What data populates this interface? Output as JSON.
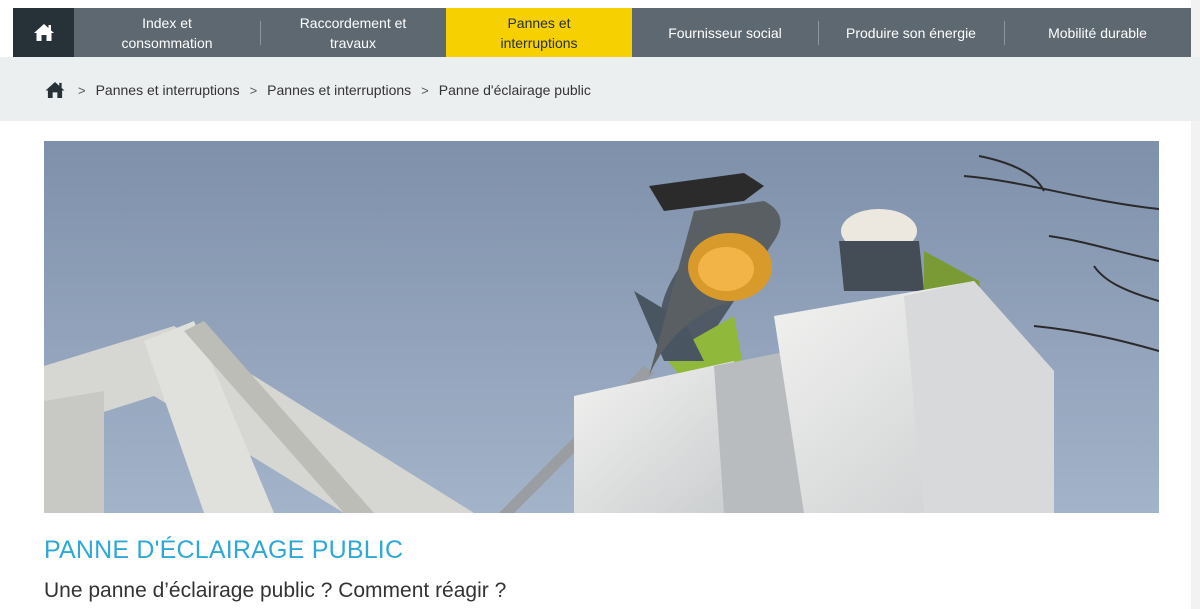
{
  "nav": {
    "home_icon": "home-icon",
    "items": [
      {
        "label": "Index et\nconsommation",
        "active": false
      },
      {
        "label": "Raccordement et\ntravaux",
        "active": false
      },
      {
        "label": "Pannes et\ninterruptions",
        "active": true
      },
      {
        "label": "Fournisseur social",
        "active": false
      },
      {
        "label": "Produire son énergie",
        "active": false
      },
      {
        "label": "Mobilité durable",
        "active": false
      }
    ]
  },
  "breadcrumb": {
    "home_icon": "home-icon",
    "separator": ">",
    "items": [
      "Pannes et interruptions",
      "Pannes et interruptions",
      "Panne d'éclairage public"
    ]
  },
  "page": {
    "title": "PANNE D'ÉCLAIRAGE PUBLIC",
    "subtitle": "Une panne d’éclairage public ? Comment réagir ?"
  },
  "colors": {
    "nav_bg": "#5d6870",
    "nav_home_bg": "#263238",
    "nav_active": "#f6d000",
    "title": "#2fa8d8",
    "crumb_bg": "#eceff0"
  }
}
